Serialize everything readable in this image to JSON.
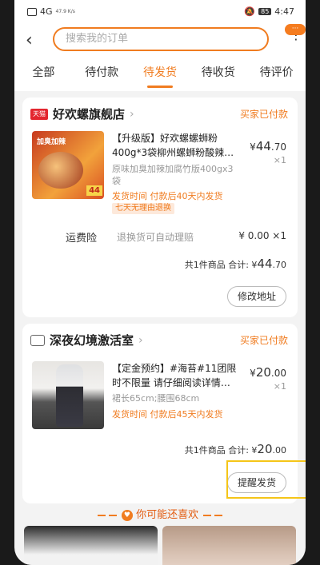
{
  "status_bar": {
    "network": "4G",
    "speed": "47.9 K/s",
    "battery": "85",
    "time": "4:47"
  },
  "topbar": {
    "back": "‹",
    "search_placeholder": "搜索我的订单",
    "more": "⋮",
    "badge": "···"
  },
  "tabs": [
    "全部",
    "待付款",
    "待发货",
    "待收货",
    "待评价"
  ],
  "active_tab": "待发货",
  "orders": [
    {
      "shop_badge": "天猫",
      "shop": "好欢螺旗舰店",
      "status": "买家已付款",
      "thumb_label": "加臭加辣",
      "thumb_price": "44",
      "title": "【升级版】好欢螺螺蛳粉400g*3袋柳州螺蛳粉酸辣…",
      "sku": "原味加臭加辣加腐竹版400gx3袋",
      "ship": "发货时间  付款后40天内发货",
      "return_tag": "七天无理由退换",
      "price_prefix": "¥",
      "price_main": "44",
      "price_dec": ".70",
      "qty": "×1",
      "insurance_label": "运费险",
      "insurance_desc": "退换货可自动理赔",
      "insurance_price": "¥ 0.00 ×1",
      "total_label": "共1件商品  合计: ¥",
      "total_main": "44",
      "total_dec": ".70",
      "button": "修改地址"
    },
    {
      "shop": "深夜幻境激活室",
      "status": "买家已付款",
      "title": "【定金预约】#海苔#11团限时不限量 请仔细阅读详情…",
      "sku": "裙长65cm;腰围68cm",
      "ship": "发货时间  付款后45天内发货",
      "price_prefix": "¥",
      "price_main": "20",
      "price_dec": ".00",
      "qty": "×1",
      "total_label": "共1件商品  合计: ¥",
      "total_main": "20",
      "total_dec": ".00",
      "button": "提醒发货"
    }
  ],
  "recommend": {
    "heart": "♥",
    "label": "你可能还喜欢"
  }
}
